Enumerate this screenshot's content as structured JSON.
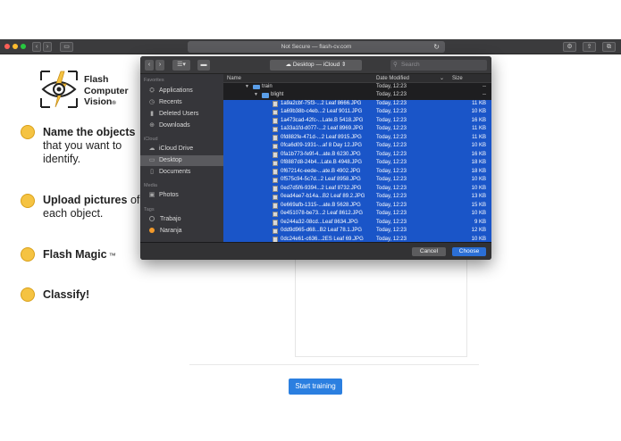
{
  "browser": {
    "address": "Not Secure — flash-cv.com",
    "reload_icon": "reload-icon",
    "traffic_lights": [
      "#ff5f57",
      "#febc2e",
      "#28c840"
    ]
  },
  "brand": {
    "line1": "Flash",
    "line2": "Computer",
    "line3": "Vision",
    "trademark": "®",
    "logo_icon": "eye-lightning-icon",
    "logo_color": "#f5c342"
  },
  "steps": [
    {
      "bold": "Name the objects",
      "rest": "that you want to identify."
    },
    {
      "bold": "Upload pictures",
      "rest": " of each object."
    },
    {
      "bold": "Flash Magic",
      "rest": " ™"
    },
    {
      "bold": "Classify!",
      "rest": ""
    }
  ],
  "start_button": "Start training",
  "dialog": {
    "location": "Desktop — iCloud",
    "search_placeholder": "Search",
    "columns": {
      "name": "Name",
      "date": "Date Modified",
      "size": "Size"
    },
    "sidebar": {
      "favorites_label": "Favorites",
      "favorites": [
        {
          "label": "Applications",
          "icon": "applications-icon"
        },
        {
          "label": "Recents",
          "icon": "clock-icon"
        },
        {
          "label": "Deleted Users",
          "icon": "folder-icon"
        },
        {
          "label": "Downloads",
          "icon": "download-icon"
        }
      ],
      "icloud_label": "iCloud",
      "icloud": [
        {
          "label": "iCloud Drive",
          "icon": "cloud-icon"
        },
        {
          "label": "Desktop",
          "icon": "desktop-icon"
        },
        {
          "label": "Documents",
          "icon": "document-icon"
        }
      ],
      "media_label": "Media",
      "media": [
        {
          "label": "Photos",
          "icon": "photos-icon"
        }
      ],
      "tags_label": "Tags",
      "tags": [
        {
          "label": "Trabajo",
          "color": "#9a9a9a"
        },
        {
          "label": "Naranja",
          "color": "#f39a2b"
        }
      ]
    },
    "folders": [
      {
        "name": "train",
        "date": "Today, 12:23",
        "size": "--"
      },
      {
        "name": "blight",
        "date": "Today, 12:23",
        "size": "--"
      }
    ],
    "files": [
      {
        "name": "1a9a2cbf-75f3-...2 Leaf 8666.JPG",
        "date": "Today, 12:23",
        "size": "11 KB"
      },
      {
        "name": "1a69b38b-c4eb...2 Leaf 9011.JPG",
        "date": "Today, 12:23",
        "size": "10 KB"
      },
      {
        "name": "1a473cad-42fc-...Late.B 5418.JPG",
        "date": "Today, 12:23",
        "size": "16 KB"
      },
      {
        "name": "1a33a1fd-d077-...2 Leaf 8969.JPG",
        "date": "Today, 12:23",
        "size": "11 KB"
      },
      {
        "name": "0fd882fe-471d-...2 Leaf 8915.JPG",
        "date": "Today, 12:23",
        "size": "11 KB"
      },
      {
        "name": "0fca6d09-1931-...af 8 Day 12.JPG",
        "date": "Today, 12:23",
        "size": "10 KB"
      },
      {
        "name": "0fa1b773-fe9f-4...ate.B 6230.JPG",
        "date": "Today, 12:23",
        "size": "16 KB"
      },
      {
        "name": "0f8887d8-24b4...Late.B 4948.JPG",
        "date": "Today, 12:23",
        "size": "18 KB"
      },
      {
        "name": "0f67214c-eede-...ate.B 4902.JPG",
        "date": "Today, 12:23",
        "size": "18 KB"
      },
      {
        "name": "0f575c94-5c7d...2 Leaf 8958.JPG",
        "date": "Today, 12:23",
        "size": "10 KB"
      },
      {
        "name": "0ed7d5f6-9394...2 Leaf 8732.JPG",
        "date": "Today, 12:23",
        "size": "10 KB"
      },
      {
        "name": "0ead4ae7-b14a...B2 Leaf 89.2.JPG",
        "date": "Today, 12:23",
        "size": "13 KB"
      },
      {
        "name": "0e669afb-1315-...ate.B 5628.JPG",
        "date": "Today, 12:23",
        "size": "15 KB"
      },
      {
        "name": "0e451078-be73...2 Leaf 8612.JPG",
        "date": "Today, 12:23",
        "size": "10 KB"
      },
      {
        "name": "0e244a32-08cd...Leaf 8634.JPG",
        "date": "Today, 12:23",
        "size": "9 KB"
      },
      {
        "name": "0dd9d965-d68...B2 Leaf 78.1.JPG",
        "date": "Today, 12:23",
        "size": "12 KB"
      },
      {
        "name": "0dc24e61-c636...2ES Leaf 69.JPG",
        "date": "Today, 12:23",
        "size": "10 KB"
      }
    ],
    "cancel_label": "Cancel",
    "choose_label": "Choose"
  }
}
